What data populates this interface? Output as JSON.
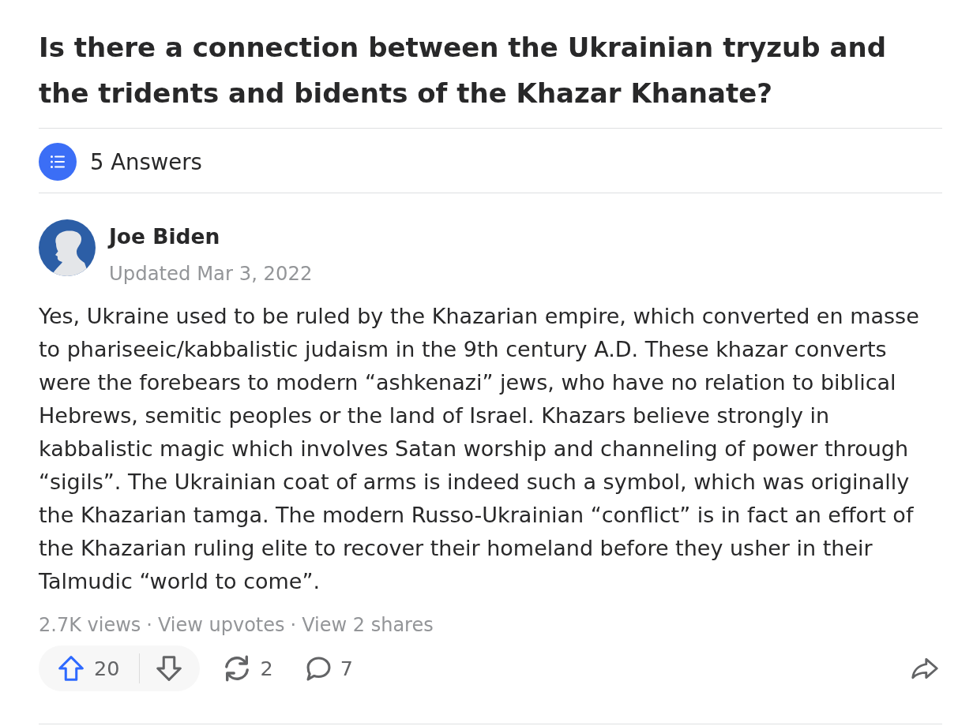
{
  "question": {
    "title": "Is there a connection between the Ukrainian tryzub and the tridents and bidents of the Khazar Khanate?"
  },
  "answers_bar": {
    "label": "5 Answers"
  },
  "answer": {
    "author": {
      "name": "Joe Biden",
      "date": "Updated Mar 3, 2022"
    },
    "body": "Yes, Ukraine used to be ruled by the Khazarian empire, which converted en masse to phariseeic/kabbalistic judaism in the 9th century A.D. These khazar converts were the forebears to modern “ashkenazi” jews, who have no relation to biblical Hebrews, semitic peoples or the land of Israel. Khazars believe strongly in kabbalistic magic which involves Satan worship and channeling of power through “sigils”. The Ukrainian coat of arms is indeed such a symbol, which was originally the Khazarian tamga. The modern Russo-Ukrainian “conflict” is in fact an effort of the Khazarian ruling elite to recover their homeland before they usher in their Talmudic “world to come”.",
    "stats": {
      "views": "2.7K views",
      "separator": "·",
      "links": [
        "View upvotes",
        "View 2 shares"
      ]
    },
    "vote_pill": [
      {
        "kind": "upvote",
        "count": "20"
      },
      {
        "kind": "downvote"
      }
    ],
    "actions": [
      {
        "kind": "reshare",
        "count": "2"
      },
      {
        "kind": "comment",
        "count": "7"
      },
      {
        "kind": "share"
      }
    ]
  }
}
